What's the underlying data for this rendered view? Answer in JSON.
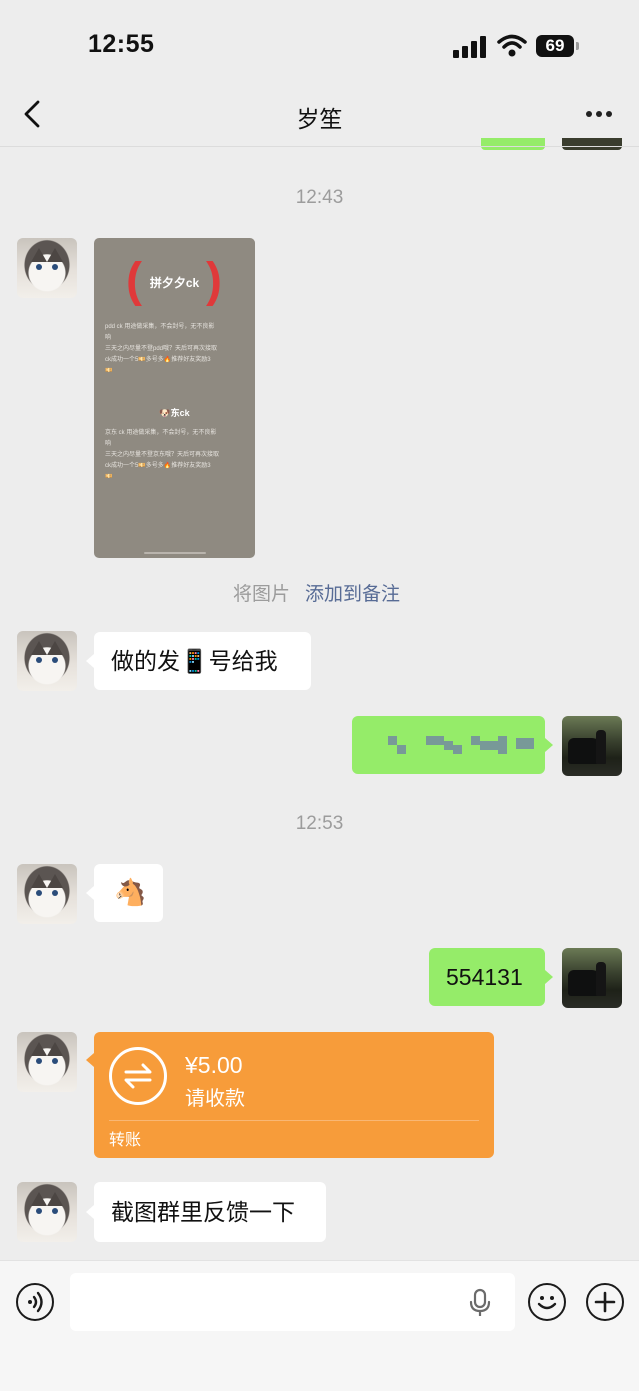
{
  "status_bar": {
    "time": "12:55",
    "battery": "69"
  },
  "header": {
    "title": "岁笙"
  },
  "messages": {
    "ts1": "12:43",
    "image": {
      "heading": "拼夕夕ck",
      "line1": "pdd ck 用途做采集，不会封号，无不良影",
      "line2": "响",
      "line3": "三天之内尽量不登pdd哦？天后可再次接取",
      "line4": "ck成功一个5💴多号多🔥推荐好友奖励3",
      "line5": "💴",
      "subhead": "🐶东ck",
      "line6": "京东 ck 用途做采集，不会封号，无不良影",
      "line7": "响",
      "line8": "三天之内尽量不登京东哦？天后可再次接取",
      "line9": "ck成功一个5💴多号多🔥推荐好友奖励3",
      "line10": "💴"
    },
    "note_prefix": "将图片",
    "note_link": "添加到备注",
    "msg1": "做的发📱号给我",
    "ts2": "12:53",
    "horse": "🐴",
    "msg_code": "554131",
    "transfer": {
      "amount": "¥5.00",
      "status": "请收款",
      "label": "转账"
    },
    "msg_last": "截图群里反馈一下"
  },
  "colors": {
    "green_bubble": "#95ec69",
    "transfer": "#f79c3a",
    "link": "#576b95"
  },
  "icons": [
    "signal-icon",
    "wifi-icon",
    "back-icon",
    "more-icon",
    "transfer-arrows-icon",
    "voice-icon",
    "microphone-icon",
    "emoji-icon",
    "plus-icon"
  ]
}
